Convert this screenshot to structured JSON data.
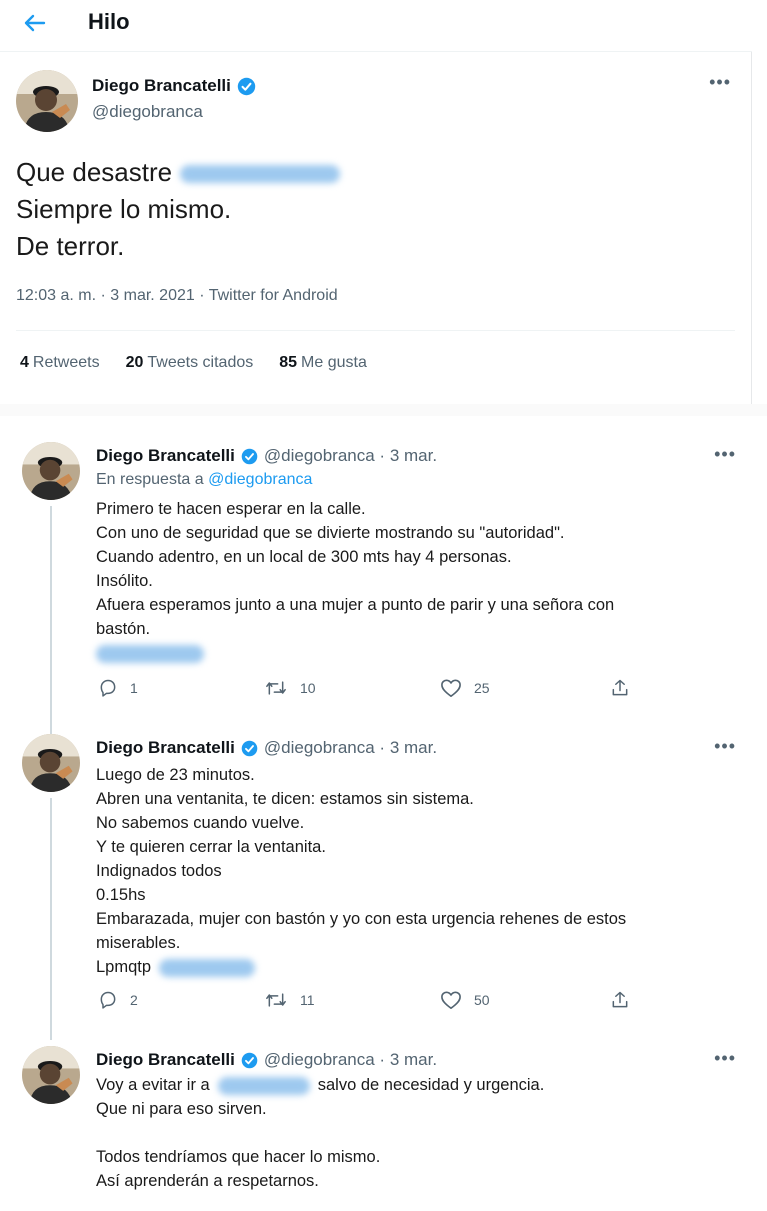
{
  "header": {
    "title": "Hilo"
  },
  "main_tweet": {
    "name": "Diego Brancatelli",
    "handle": "@diegobranca",
    "lines": [
      "Que desastre",
      "Siempre lo mismo.",
      "De terror."
    ],
    "meta": "12:03 a. m. · 3 mar. 2021 · Twitter for Android",
    "stats": [
      {
        "count": "4",
        "label": "Retweets"
      },
      {
        "count": "20",
        "label": "Tweets citados"
      },
      {
        "count": "85",
        "label": "Me gusta"
      }
    ]
  },
  "replies": [
    {
      "name": "Diego Brancatelli",
      "handle": "@diegobranca · 3 mar.",
      "in_reply_prefix": "En respuesta a",
      "in_reply_handle": "@diegobranca",
      "lines": [
        "Primero te hacen esperar en la calle.",
        "Con uno de seguridad que se divierte mostrando su \"autoridad\".",
        "Cuando adentro, en un local de 300 mts hay 4 personas.",
        "Insólito.",
        "Afuera esperamos junto a una mujer a punto de parir y una señora con",
        "bastón."
      ],
      "replies_count": "1",
      "retweets_count": "10",
      "likes_count": "25"
    },
    {
      "name": "Diego Brancatelli",
      "handle": "@diegobranca · 3 mar.",
      "lines": [
        "Luego de 23 minutos.",
        "Abren una ventanita, te dicen: estamos sin sistema.",
        "No sabemos cuando vuelve.",
        "Y te quieren cerrar la  ventanita.",
        "Indignados todos",
        "0.15hs",
        "Embarazada, mujer con bastón y yo con esta urgencia rehenes de estos",
        "miserables.",
        "Lpmqtp"
      ],
      "replies_count": "2",
      "retweets_count": "11",
      "likes_count": "50"
    },
    {
      "name": "Diego Brancatelli",
      "handle": "@diegobranca · 3 mar.",
      "lines": [
        "Voy a evitar ir a",
        "salvo de necesidad y urgencia.",
        "Que ni para eso sirven.",
        "",
        "Todos tendríamos que hacer lo mismo.",
        "Así aprenderán a respetarnos."
      ]
    }
  ],
  "icons": {
    "back": "arrow-left-icon",
    "verified": "verified-badge-icon",
    "more": "more-icon",
    "reply": "reply-icon",
    "retweet": "retweet-icon",
    "like": "heart-icon",
    "share": "share-icon"
  },
  "colors": {
    "accent": "#1d9bf0",
    "secondary_text": "#536471",
    "thread_line": "#cfd9de"
  }
}
